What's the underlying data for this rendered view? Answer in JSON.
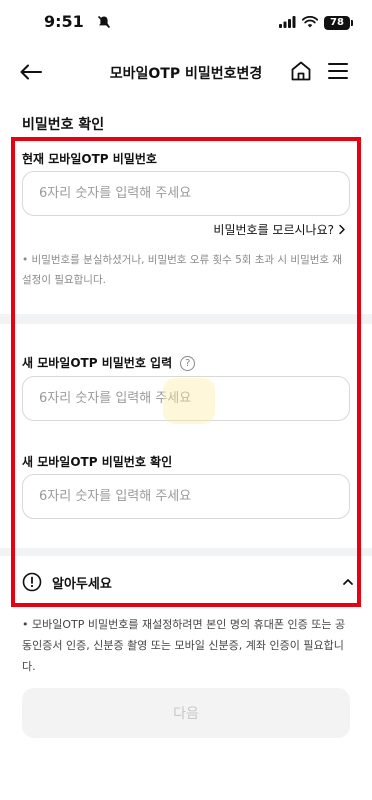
{
  "status_bar": {
    "time": "9:51",
    "battery": "78"
  },
  "header": {
    "title": "모바일OTP 비밀번호변경"
  },
  "section": {
    "title": "비밀번호 확인"
  },
  "current_password": {
    "label": "현재 모바일OTP 비밀번호",
    "placeholder": "6자리 숫자를 입력해 주세요",
    "forgot_link": "비밀번호를 모르시나요?",
    "notice": "• 비밀번호를 분실하셨거나, 비밀번호 오류 횟수 5회 초과 시 비밀번호 재설정이 필요합니다."
  },
  "new_password": {
    "label": "새 모바일OTP 비밀번호 입력",
    "help_icon": "?",
    "placeholder": "6자리 숫자를 입력해 주세요"
  },
  "confirm_password": {
    "label": "새 모바일OTP 비밀번호 확인",
    "placeholder": "6자리 숫자를 입력해 주세요"
  },
  "notice_section": {
    "title": "알아두세요",
    "body": "• 모바일OTP 비밀번호를 재설정하려면 본인 명의 휴대폰 인증 또는 공동인증서 인증, 신분증 촬영 또는 모바일 신분증, 계좌 인증이 필요합니다."
  },
  "next_button": {
    "label": "다음"
  },
  "colors": {
    "highlight": "#e60012",
    "divider": "#f2f3f5",
    "disabled_button": "#f3f3f3"
  }
}
